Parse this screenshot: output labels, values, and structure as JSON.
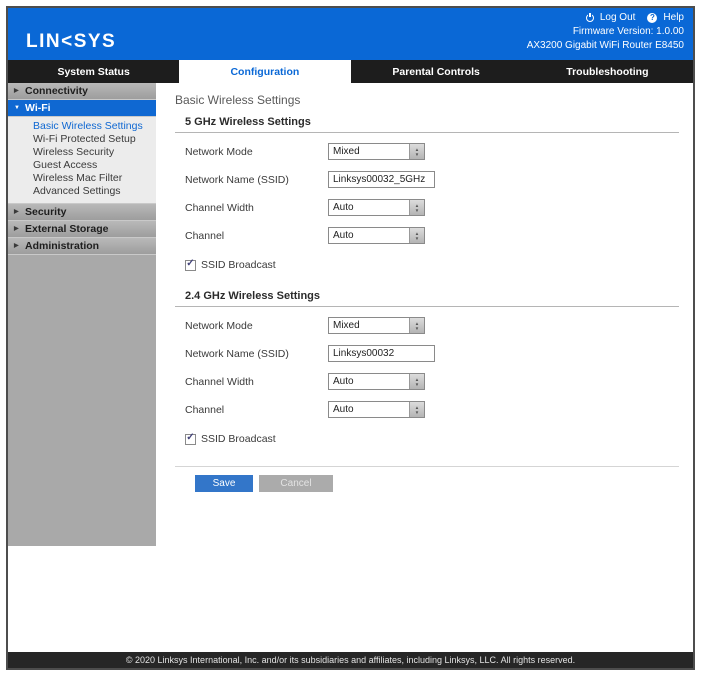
{
  "colors": {
    "header_blue": "#0a68d6",
    "selected_nav_blue": "#0f68d2",
    "save_button_blue": "#3376c9",
    "tabbar_black": "#1d1d1d",
    "sidebar_gray": "#a9a9a9"
  },
  "icons": {
    "check": "✓",
    "spinner_up": "▲",
    "spinner_down": "▼",
    "collapsed": "▶",
    "expanded": "▼",
    "help": "?"
  },
  "header": {
    "logo_text": "LIN<SYS",
    "logout_label": "Log Out",
    "help_label": "Help",
    "firmware_line": "Firmware Version: 1.0.00",
    "model_line": "AX3200 Gigabit WiFi Router  E8450"
  },
  "tabs": [
    {
      "label": "System Status"
    },
    {
      "label": "Configuration"
    },
    {
      "label": "Parental Controls"
    },
    {
      "label": "Troubleshooting"
    }
  ],
  "sidebar": {
    "groups": [
      {
        "label": "Connectivity"
      },
      {
        "label": "Wi-Fi"
      },
      {
        "label": "Security"
      },
      {
        "label": "External Storage"
      },
      {
        "label": "Administration"
      }
    ],
    "wifi_subitems": [
      {
        "label": "Basic Wireless Settings"
      },
      {
        "label": "Wi-Fi Protected Setup"
      },
      {
        "label": "Wireless Security"
      },
      {
        "label": "Guest Access"
      },
      {
        "label": "Wireless Mac Filter"
      },
      {
        "label": "Advanced Settings"
      }
    ]
  },
  "main": {
    "page_title": "Basic Wireless Settings",
    "sections": [
      {
        "title": "5 GHz Wireless Settings",
        "network_mode_label": "Network Mode",
        "network_mode_value": "Mixed",
        "ssid_label": "Network Name (SSID)",
        "ssid_value": "Linksys00032_5GHz",
        "channel_width_label": "Channel Width",
        "channel_width_value": "Auto",
        "channel_label": "Channel",
        "channel_value": "Auto",
        "ssid_broadcast_label": "SSID Broadcast",
        "ssid_broadcast_checked": true
      },
      {
        "title": "2.4 GHz Wireless Settings",
        "network_mode_label": "Network Mode",
        "network_mode_value": "Mixed",
        "ssid_label": "Network Name (SSID)",
        "ssid_value": "Linksys00032",
        "channel_width_label": "Channel Width",
        "channel_width_value": "Auto",
        "channel_label": "Channel",
        "channel_value": "Auto",
        "ssid_broadcast_label": "SSID Broadcast",
        "ssid_broadcast_checked": true
      }
    ],
    "buttons": {
      "save": "Save",
      "cancel": "Cancel"
    }
  },
  "footer": {
    "copyright": "© 2020 Linksys International, Inc. and/or its subsidiaries and affiliates, including Linksys, LLC. All rights reserved."
  }
}
